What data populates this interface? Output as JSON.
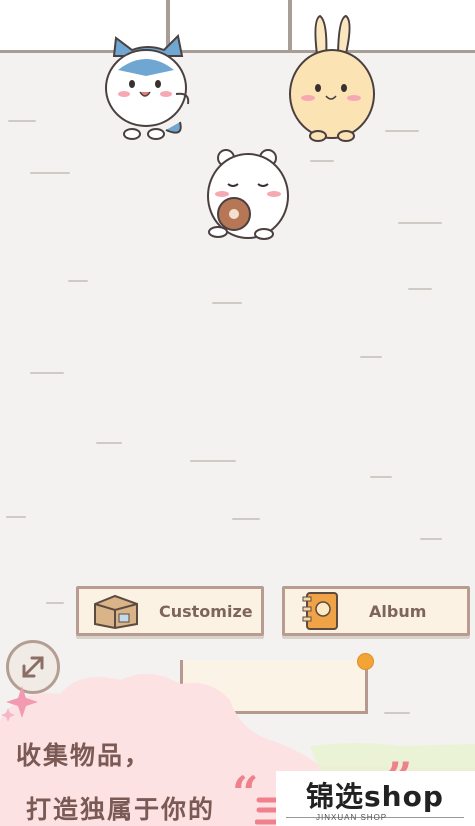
{
  "buttons": {
    "customize_label": "Customize",
    "album_label": "Album"
  },
  "promo": {
    "line1": "收集物品，",
    "line2": "打造独属于你的",
    "quote_open": "“",
    "quote_close": "”"
  },
  "shop": {
    "name": "锦选shop",
    "subtitle": "JINXUAN SHOP"
  },
  "colors": {
    "accent_pink": "#f0808b",
    "button_fill": "#fbf2e3",
    "button_border": "#b89c91",
    "badge_orange": "#f3a437"
  },
  "icons": {
    "customize": "box-icon",
    "album": "notebook-icon",
    "expand": "expand-arrows-icon"
  }
}
